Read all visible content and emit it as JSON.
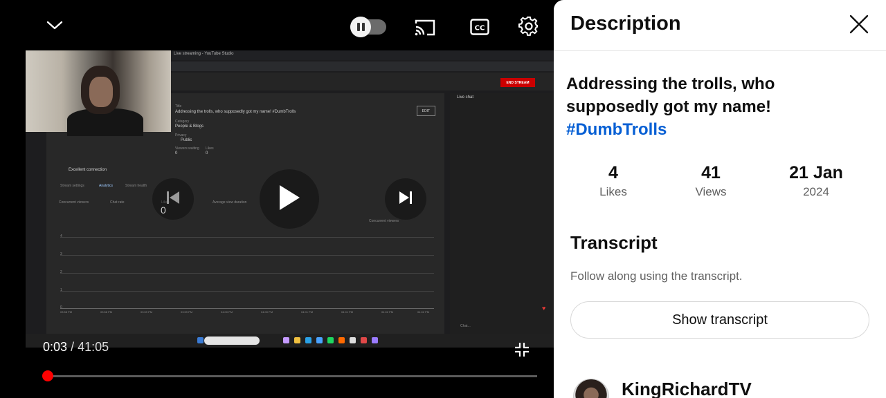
{
  "player": {
    "current_time": "0:03",
    "duration": "/ 41:05",
    "progress_fraction": 0.001,
    "icons": {
      "minimize": "chevron-down-icon",
      "autoplay": "autoplay-toggle-icon",
      "cast": "cast-icon",
      "captions": "cc-icon",
      "settings": "gear-icon",
      "previous": "previous-icon",
      "play": "play-icon",
      "next": "next-icon",
      "exit_fullscreen": "exit-fullscreen-icon"
    },
    "overlay_badge": "0"
  },
  "video_content": {
    "browser_tab": "Live streaming - YouTube Studio",
    "end_stream_label": "END STREAM",
    "title_label": "Title",
    "title_value": "Addressing the trolls, who supposedly got my name! #DumbTrolls",
    "edit_label": "EDIT",
    "category_label": "Category",
    "category_value": "People & Blogs",
    "privacy_label": "Privacy",
    "privacy_value": "Public",
    "viewers_waiting_label": "Viewers waiting",
    "viewers_waiting_value": "0",
    "likes_label": "Likes",
    "likes_value": "0",
    "connection_status": "Excellent connection",
    "tabs": [
      "Stream settings",
      "Analytics",
      "Stream health"
    ],
    "metrics": [
      "Concurrent viewers",
      "Chat rate",
      "Likes",
      "Average view duration"
    ],
    "metric_dropdown": "Concurrent viewers",
    "y_ticks": [
      "4",
      "3",
      "2",
      "1",
      "0"
    ],
    "x_ticks": [
      "03:58 PM",
      "03:58 PM",
      "03:59 PM",
      "03:59 PM",
      "04:00 PM",
      "04:00 PM",
      "04:01 PM",
      "04:01 PM",
      "04:02 PM",
      "04:02 PM"
    ],
    "live_chat_label": "Live chat",
    "chat_placeholder": "Chat..."
  },
  "description_panel": {
    "heading": "Description",
    "video_title": "Addressing the trolls, who supposedly got my name!",
    "hashtag": "#DumbTrolls",
    "stats": {
      "likes_value": "4",
      "likes_label": "Likes",
      "views_value": "41",
      "views_label": "Views",
      "date_value": "21 Jan",
      "date_year": "2024"
    },
    "transcript_heading": "Transcript",
    "transcript_subtext": "Follow along using the transcript.",
    "transcript_button": "Show transcript",
    "channel_name": "KingRichardTV"
  }
}
